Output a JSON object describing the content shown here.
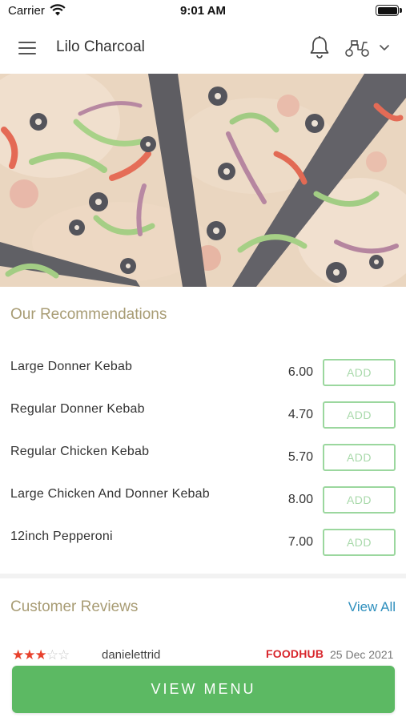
{
  "status_bar": {
    "carrier": "Carrier",
    "time": "9:01 AM"
  },
  "header": {
    "title": "Lilo Charcoal"
  },
  "recommendations": {
    "title": "Our Recommendations",
    "items": [
      {
        "name": "Large Donner Kebab",
        "price": "6.00",
        "add_label": "ADD"
      },
      {
        "name": "Regular Donner Kebab",
        "price": "4.70",
        "add_label": "ADD"
      },
      {
        "name": "Regular Chicken Kebab",
        "price": "5.70",
        "add_label": "ADD"
      },
      {
        "name": "Large Chicken And Donner Kebab",
        "price": "8.00",
        "add_label": "ADD"
      },
      {
        "name": "12inch Pepperoni",
        "price": "7.00",
        "add_label": "ADD"
      }
    ]
  },
  "reviews": {
    "title": "Customer Reviews",
    "view_all": "View All",
    "first": {
      "rating": 3,
      "max_rating": 5,
      "reviewer": "danielettrid",
      "source": "FOODHUB",
      "date": "25 Dec 2021"
    }
  },
  "footer": {
    "view_menu": "VIEW MENU"
  },
  "colors": {
    "accent_green": "#5cb963",
    "section_title": "#a89c74",
    "link_blue": "#2e8fbd",
    "star_red": "#e8412c",
    "foodhub_red": "#d8262c"
  }
}
